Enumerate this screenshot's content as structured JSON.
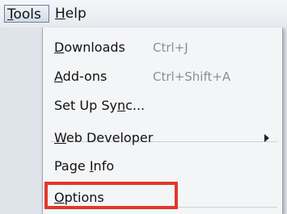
{
  "menubar": {
    "tools": {
      "pre": "",
      "acc": "T",
      "post": "ools"
    },
    "help": {
      "pre": "",
      "acc": "H",
      "post": "elp"
    }
  },
  "menu": {
    "items": [
      {
        "pre": "",
        "acc": "D",
        "post": "ownloads",
        "shortcut": "Ctrl+J"
      },
      {
        "pre": "",
        "acc": "A",
        "post": "dd-ons",
        "shortcut": "Ctrl+Shift+A"
      },
      {
        "pre": "Set Up Sy",
        "acc": "n",
        "post": "c..."
      },
      {
        "pre": "",
        "acc": "W",
        "post": "eb Developer"
      },
      {
        "pre": "Page ",
        "acc": "I",
        "post": "nfo"
      },
      {
        "pre": "",
        "acc": "O",
        "post": "ptions"
      }
    ]
  },
  "colors": {
    "highlight": "#e0392b"
  }
}
